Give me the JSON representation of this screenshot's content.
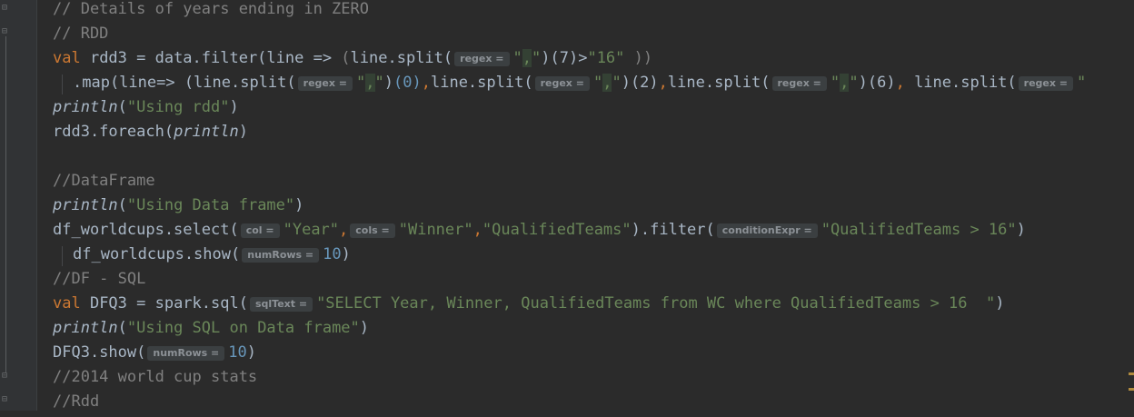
{
  "editor": {
    "lines": [
      {
        "segs": [
          {
            "c": "cmt",
            "t": "// Details of years ending in ZERO"
          }
        ]
      },
      {
        "segs": [
          {
            "c": "cmt",
            "t": "// RDD"
          }
        ]
      },
      {
        "segs": [
          {
            "c": "kw",
            "t": "val "
          },
          {
            "c": "pl",
            "t": "rdd3 = data.filter(line => "
          },
          {
            "c": "cmt",
            "t": "("
          },
          {
            "c": "pl",
            "t": "line.split("
          },
          {
            "h": "regex ="
          },
          {
            "c": "str",
            "t": "\""
          },
          {
            "c": "str strhl",
            "t": ","
          },
          {
            "c": "str",
            "t": "\""
          },
          {
            "c": "pl",
            "t": ")(7)>"
          },
          {
            "c": "str",
            "t": "\"16\""
          },
          {
            "c": "cmt",
            "t": " ))"
          }
        ]
      },
      {
        "indent": 1,
        "segs": [
          {
            "c": "pl",
            "t": ".map(line=> (line.split("
          },
          {
            "h": "regex ="
          },
          {
            "c": "str",
            "t": "\""
          },
          {
            "c": "str strhl",
            "t": ","
          },
          {
            "c": "str",
            "t": "\""
          },
          {
            "c": "pl",
            "t": ")"
          },
          {
            "c": "num",
            "t": "(0)"
          },
          {
            "c": "orange",
            "t": ","
          },
          {
            "c": "pl",
            "t": "line.split("
          },
          {
            "h": "regex ="
          },
          {
            "c": "str",
            "t": "\""
          },
          {
            "c": "str strhl",
            "t": ","
          },
          {
            "c": "str",
            "t": "\""
          },
          {
            "c": "pl",
            "t": ")(2)"
          },
          {
            "c": "orange",
            "t": ","
          },
          {
            "c": "pl",
            "t": "line.split("
          },
          {
            "h": "regex ="
          },
          {
            "c": "str",
            "t": "\""
          },
          {
            "c": "str strhl",
            "t": ","
          },
          {
            "c": "str",
            "t": "\""
          },
          {
            "c": "pl",
            "t": ")(6)"
          },
          {
            "c": "orange",
            "t": ", "
          },
          {
            "c": "pl",
            "t": "line.split("
          },
          {
            "h": "regex ="
          },
          {
            "c": "str",
            "t": "\""
          }
        ]
      },
      {
        "segs": [
          {
            "c": "it",
            "t": "println"
          },
          {
            "c": "pl",
            "t": "("
          },
          {
            "c": "str",
            "t": "\"Using rdd\""
          },
          {
            "c": "pl",
            "t": ")"
          }
        ]
      },
      {
        "segs": [
          {
            "c": "pl",
            "t": "rdd3.foreach("
          },
          {
            "c": "it",
            "t": "println"
          },
          {
            "c": "pl",
            "t": ")"
          }
        ]
      },
      {
        "segs": []
      },
      {
        "segs": [
          {
            "c": "cmt",
            "t": "//DataFrame"
          }
        ]
      },
      {
        "segs": [
          {
            "c": "it",
            "t": "println"
          },
          {
            "c": "pl",
            "t": "("
          },
          {
            "c": "str",
            "t": "\"Using Data frame\""
          },
          {
            "c": "pl",
            "t": ")"
          }
        ]
      },
      {
        "segs": [
          {
            "c": "pl",
            "t": "df_worldcups.select("
          },
          {
            "h": "col ="
          },
          {
            "c": "str",
            "t": "\"Year\""
          },
          {
            "c": "orange",
            "t": ","
          },
          {
            "h": "cols ="
          },
          {
            "c": "str",
            "t": "\"Winner\""
          },
          {
            "c": "orange",
            "t": ","
          },
          {
            "c": "str",
            "t": "\"QualifiedTeams\""
          },
          {
            "c": "pl",
            "t": ").filter("
          },
          {
            "h": "conditionExpr ="
          },
          {
            "c": "str",
            "t": "\"QualifiedTeams > 16\""
          },
          {
            "c": "pl",
            "t": ")"
          }
        ]
      },
      {
        "indent": 1,
        "segs": [
          {
            "c": "pl",
            "t": "df_worldcups.show("
          },
          {
            "h": "numRows ="
          },
          {
            "c": "num",
            "t": "10"
          },
          {
            "c": "pl",
            "t": ")"
          }
        ]
      },
      {
        "segs": [
          {
            "c": "cmt",
            "t": "//DF - SQL"
          }
        ]
      },
      {
        "segs": [
          {
            "c": "kw",
            "t": "val "
          },
          {
            "c": "pl",
            "t": "DFQ3 = spark.sql("
          },
          {
            "h": "sqlText ="
          },
          {
            "c": "str",
            "t": "\"SELECT Year, Winner, QualifiedTeams from WC where QualifiedTeams > 16  \""
          },
          {
            "c": "pl",
            "t": ")"
          }
        ]
      },
      {
        "segs": [
          {
            "c": "it",
            "t": "println"
          },
          {
            "c": "pl",
            "t": "("
          },
          {
            "c": "str",
            "t": "\"Using SQL on Data frame\""
          },
          {
            "c": "pl",
            "t": ")"
          }
        ]
      },
      {
        "segs": [
          {
            "c": "pl",
            "t": "DFQ3.show("
          },
          {
            "h": "numRows ="
          },
          {
            "c": "num",
            "t": "10"
          },
          {
            "c": "pl",
            "t": ")"
          }
        ]
      },
      {
        "segs": [
          {
            "c": "cmt",
            "t": "//2014 world cup stats"
          }
        ]
      },
      {
        "segs": [
          {
            "c": "cmt",
            "t": "//Rdd"
          }
        ]
      }
    ]
  },
  "colors": {
    "background": "#2b2b2b",
    "comment": "#808080",
    "keyword": "#cc7832",
    "string": "#6a8759",
    "number": "#6897bb",
    "text": "#a9b7c6",
    "hint_bg": "#3b3f41"
  },
  "icons": {
    "fold": "fold-marker-icon"
  }
}
